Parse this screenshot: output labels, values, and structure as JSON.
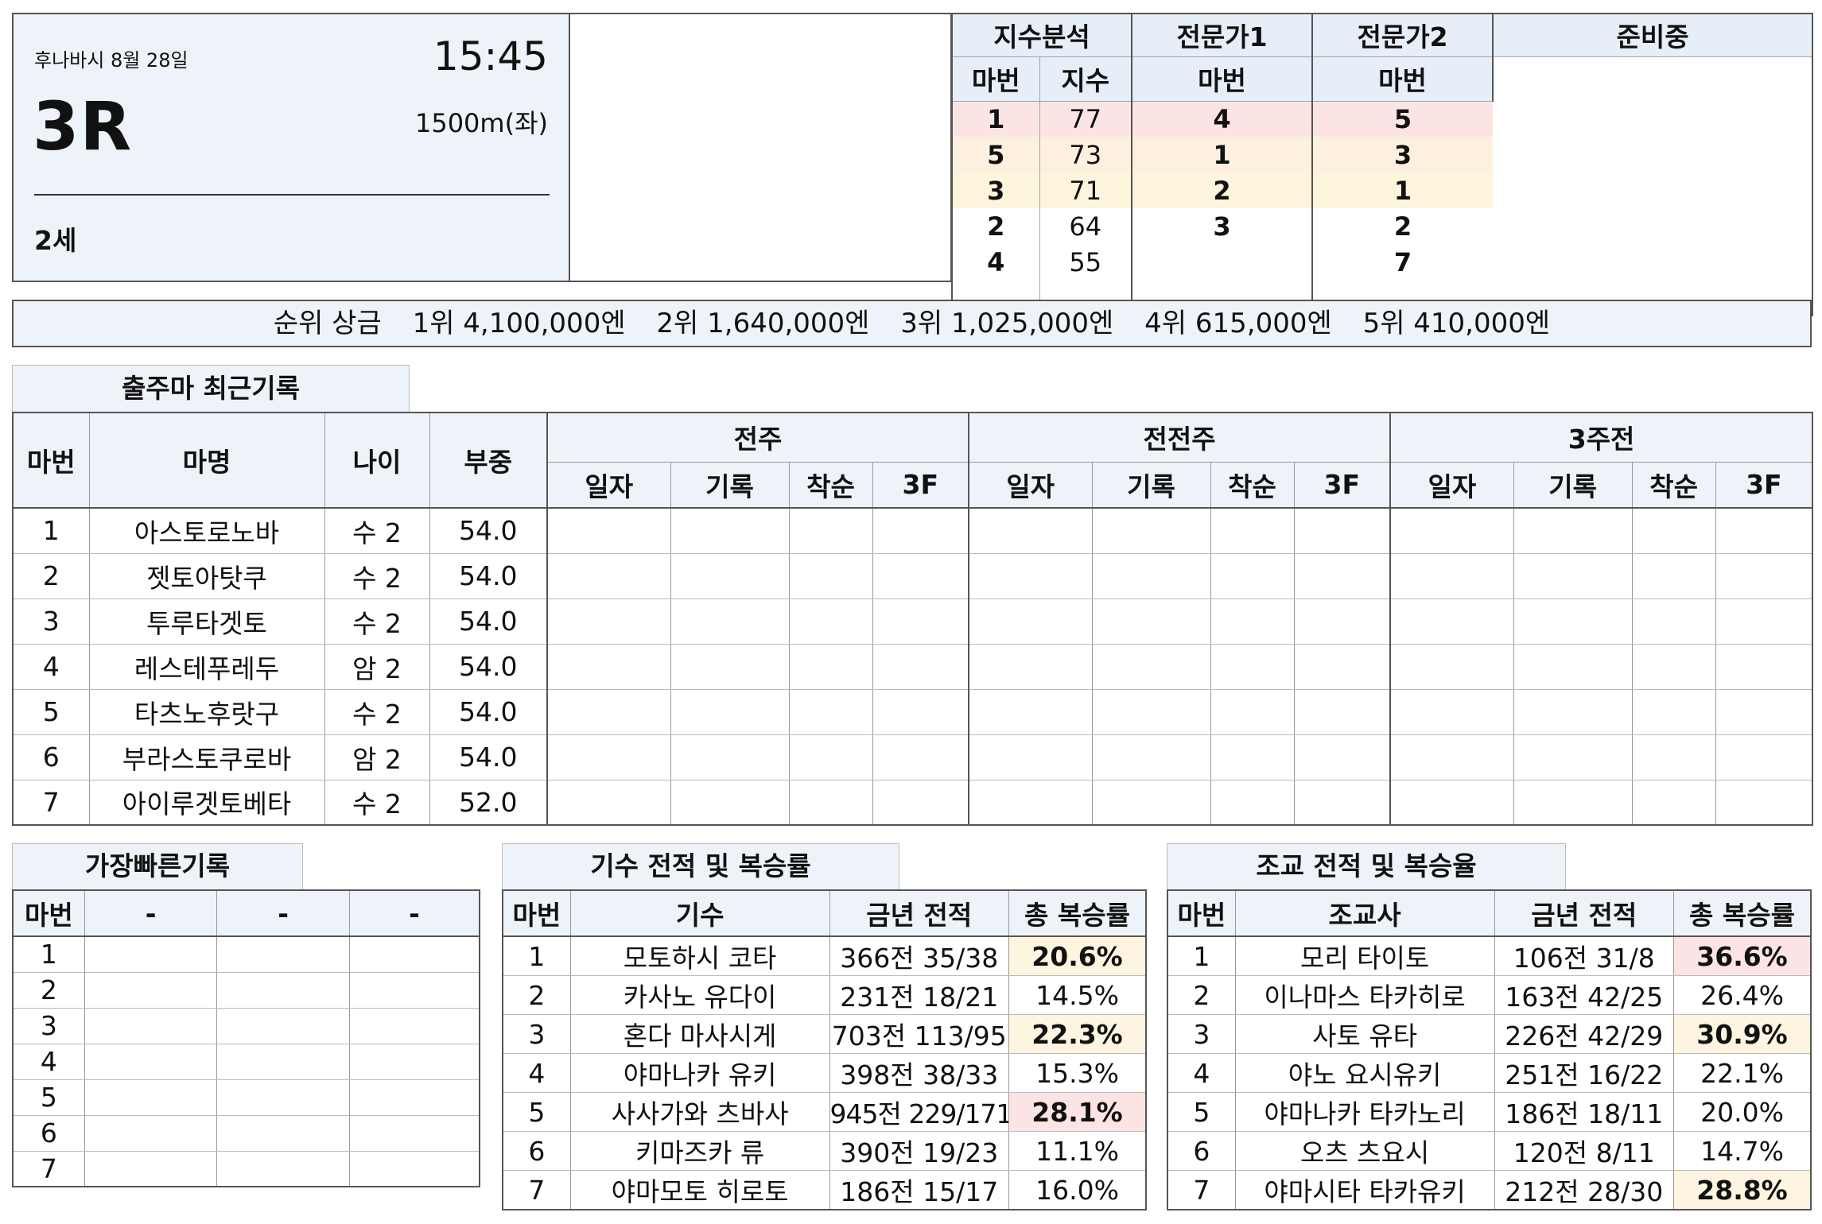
{
  "race": {
    "venue_date": "후나바시 8월 28일",
    "time": "15:45",
    "number": "3R",
    "distance": "1500m(좌)",
    "age": "2세"
  },
  "analysis": {
    "headers": {
      "index": "지수분석",
      "expert1": "전문가1",
      "expert2": "전문가2",
      "prep": "준비중"
    },
    "subheaders": {
      "horse_no": "마번",
      "score": "지수"
    },
    "index_rows": [
      {
        "no": "1",
        "score": "77"
      },
      {
        "no": "5",
        "score": "73"
      },
      {
        "no": "3",
        "score": "71"
      },
      {
        "no": "2",
        "score": "64"
      },
      {
        "no": "4",
        "score": "55"
      }
    ],
    "expert1": [
      "4",
      "1",
      "2",
      "3",
      ""
    ],
    "expert2": [
      "5",
      "3",
      "1",
      "2",
      "7"
    ],
    "row_highlight": [
      "#fde4e4",
      "#fdf0de",
      "#fdf4dc",
      "",
      ""
    ]
  },
  "prize": {
    "label": "순위 상금",
    "items": [
      "1위 4,100,000엔",
      "2위 1,640,000엔",
      "3위 1,025,000엔",
      "4위 615,000엔",
      "5위 410,000엔"
    ]
  },
  "recent": {
    "tab": "출주마 최근기록",
    "headers": {
      "no": "마번",
      "name": "마명",
      "age": "나이",
      "weight": "부중"
    },
    "groups": [
      "전주",
      "전전주",
      "3주전"
    ],
    "subheaders": [
      "일자",
      "기록",
      "착순",
      "3F"
    ],
    "rows": [
      {
        "no": "1",
        "name": "아스토로노바",
        "age": "수 2",
        "weight": "54.0"
      },
      {
        "no": "2",
        "name": "젯토아탓쿠",
        "age": "수 2",
        "weight": "54.0"
      },
      {
        "no": "3",
        "name": "투루타겟토",
        "age": "수 2",
        "weight": "54.0"
      },
      {
        "no": "4",
        "name": "레스테푸레두",
        "age": "암 2",
        "weight": "54.0"
      },
      {
        "no": "5",
        "name": "타츠노후랏구",
        "age": "수 2",
        "weight": "54.0"
      },
      {
        "no": "6",
        "name": "부라스토쿠로바",
        "age": "암 2",
        "weight": "54.0"
      },
      {
        "no": "7",
        "name": "아이루겟토베타",
        "age": "수 2",
        "weight": "52.0"
      }
    ]
  },
  "fastest": {
    "tab": "가장빠른기록",
    "headers": [
      "마번",
      "-",
      "-",
      "-"
    ],
    "rows": [
      "1",
      "2",
      "3",
      "4",
      "5",
      "6",
      "7"
    ]
  },
  "jockey": {
    "tab": "기수 전적 및 복승률",
    "headers": [
      "마번",
      "기수",
      "금년 전적",
      "총 복승률"
    ],
    "rows": [
      {
        "no": "1",
        "name": "모토하시 코타",
        "record": "366전 35/38",
        "rate": "20.6%",
        "hl": "cream"
      },
      {
        "no": "2",
        "name": "카사노 유다이",
        "record": "231전 18/21",
        "rate": "14.5%",
        "hl": ""
      },
      {
        "no": "3",
        "name": "혼다 마사시게",
        "record": "703전 113/95",
        "rate": "22.3%",
        "hl": "cream"
      },
      {
        "no": "4",
        "name": "야마나카 유키",
        "record": "398전 38/33",
        "rate": "15.3%",
        "hl": ""
      },
      {
        "no": "5",
        "name": "사사가와 츠바사",
        "record": "945전 229/171",
        "rate": "28.1%",
        "hl": "pink"
      },
      {
        "no": "6",
        "name": "키마즈카 류",
        "record": "390전 19/23",
        "rate": "11.1%",
        "hl": ""
      },
      {
        "no": "7",
        "name": "야마모토 히로토",
        "record": "186전 15/17",
        "rate": "16.0%",
        "hl": ""
      }
    ]
  },
  "trainer": {
    "tab": "조교 전적 및 복승율",
    "headers": [
      "마번",
      "조교사",
      "금년 전적",
      "총 복승률"
    ],
    "rows": [
      {
        "no": "1",
        "name": "모리 타이토",
        "record": "106전 31/8",
        "rate": "36.6%",
        "hl": "pink"
      },
      {
        "no": "2",
        "name": "이나마스 타카히로",
        "record": "163전 42/25",
        "rate": "26.4%",
        "hl": ""
      },
      {
        "no": "3",
        "name": "사토 유타",
        "record": "226전 42/29",
        "rate": "30.9%",
        "hl": "cream"
      },
      {
        "no": "4",
        "name": "야노 요시유키",
        "record": "251전 16/22",
        "rate": "22.1%",
        "hl": ""
      },
      {
        "no": "5",
        "name": "야마나카 타카노리",
        "record": "186전 18/11",
        "rate": "20.0%",
        "hl": ""
      },
      {
        "no": "6",
        "name": "오츠 츠요시",
        "record": "120전 8/11",
        "rate": "14.7%",
        "hl": ""
      },
      {
        "no": "7",
        "name": "야마시타 타카유키",
        "record": "212전 28/30",
        "rate": "28.8%",
        "hl": "cream"
      }
    ]
  }
}
